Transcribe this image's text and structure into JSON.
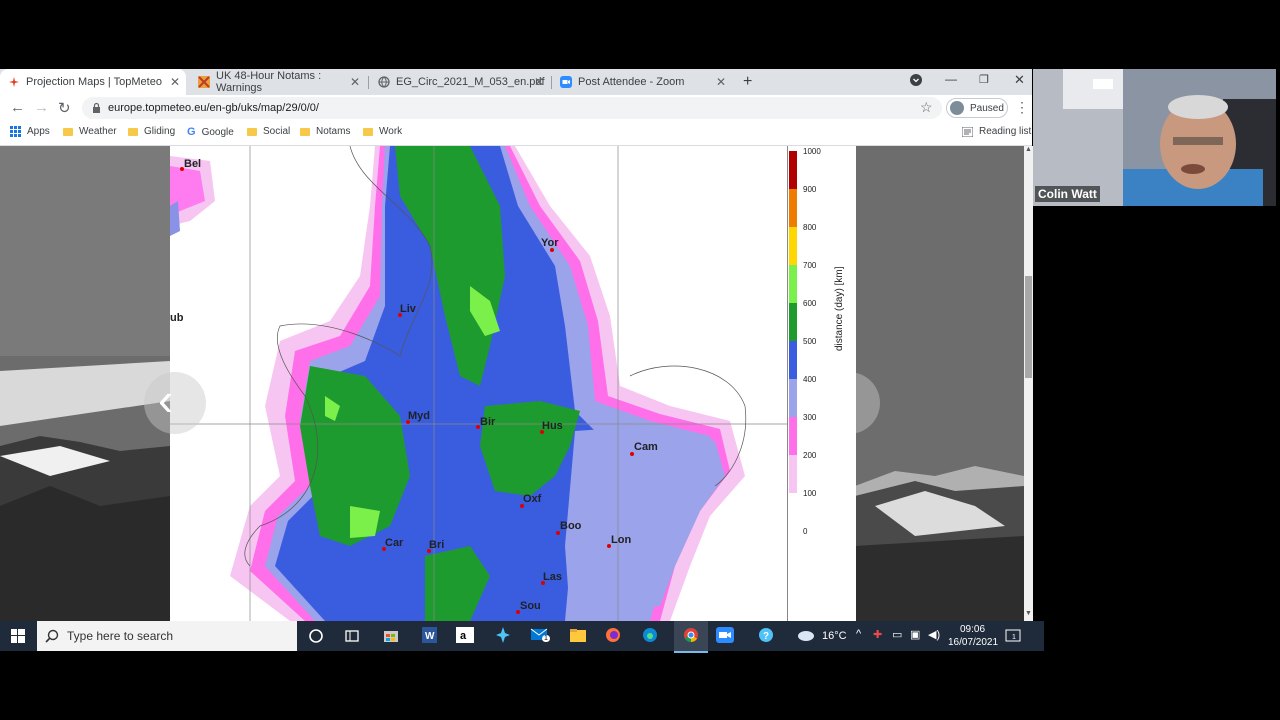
{
  "browser": {
    "tabs": [
      {
        "title": "Projection Maps | TopMeteo",
        "active": true
      },
      {
        "title": "UK 48-Hour Notams : Warnings",
        "active": false
      },
      {
        "title": "EG_Circ_2021_M_053_en.pdf",
        "active": false
      },
      {
        "title": "Post Attendee - Zoom",
        "active": false
      }
    ],
    "url": "europe.topmeteo.eu/en-gb/uks/map/29/0/0/",
    "profile_status": "Paused",
    "bookmarks": [
      "Apps",
      "Weather",
      "Gliding",
      "Google",
      "Social",
      "Notams",
      "Work"
    ],
    "reading_list": "Reading list"
  },
  "map": {
    "cities": [
      {
        "label": "Bel"
      },
      {
        "label": "Yor"
      },
      {
        "label": "Liv"
      },
      {
        "label": "ub"
      },
      {
        "label": "Myd"
      },
      {
        "label": "Bir"
      },
      {
        "label": "Hus"
      },
      {
        "label": "Cam"
      },
      {
        "label": "Oxf"
      },
      {
        "label": "Boo"
      },
      {
        "label": "Car"
      },
      {
        "label": "Bri"
      },
      {
        "label": "Lon"
      },
      {
        "label": "Las"
      },
      {
        "label": "Sou"
      }
    ],
    "legend": {
      "title": "distance (day) [km]",
      "ticks": [
        "1000",
        "900",
        "800",
        "700",
        "600",
        "500",
        "400",
        "300",
        "200",
        "100",
        "0"
      ]
    }
  },
  "taskbar": {
    "search_placeholder": "Type here to search",
    "temperature": "16°C",
    "time": "09:06",
    "date": "16/07/2021",
    "mail_badge": "1",
    "notification_badge": "1"
  },
  "webcam": {
    "name": "Colin Watt"
  }
}
